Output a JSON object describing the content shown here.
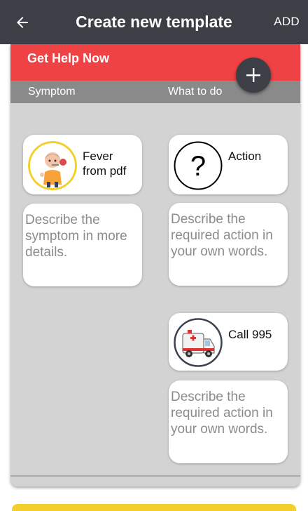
{
  "appbar": {
    "title": "Create new template",
    "add_label": "ADD",
    "back_icon": "arrow-left-icon"
  },
  "help": {
    "title": "Get Help Now",
    "col_symptom": "Symptom",
    "col_action": "What to do",
    "fab_icon": "plus-icon"
  },
  "symptom": {
    "name": "Fever from pdf",
    "placeholder": "Describe the symptom in more details."
  },
  "actions": [
    {
      "name": "Action",
      "icon": "question-mark-icon",
      "placeholder": "Describe the required action in your own words."
    },
    {
      "name": "Call 995",
      "icon": "ambulance-icon",
      "placeholder": "Describe the required action in your own words."
    }
  ],
  "colors": {
    "appbar": "#3c4046",
    "help_red": "#ef4244",
    "header_gray": "#8a8a8a",
    "panel": "#d3d3d3"
  }
}
